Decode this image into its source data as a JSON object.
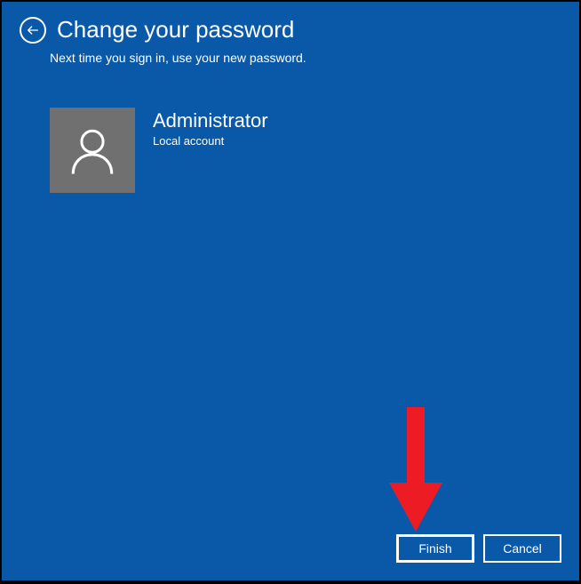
{
  "header": {
    "title": "Change your password",
    "subtitle": "Next time you sign in, use your new password."
  },
  "user": {
    "name": "Administrator",
    "account_type": "Local account"
  },
  "buttons": {
    "finish": "Finish",
    "cancel": "Cancel"
  }
}
